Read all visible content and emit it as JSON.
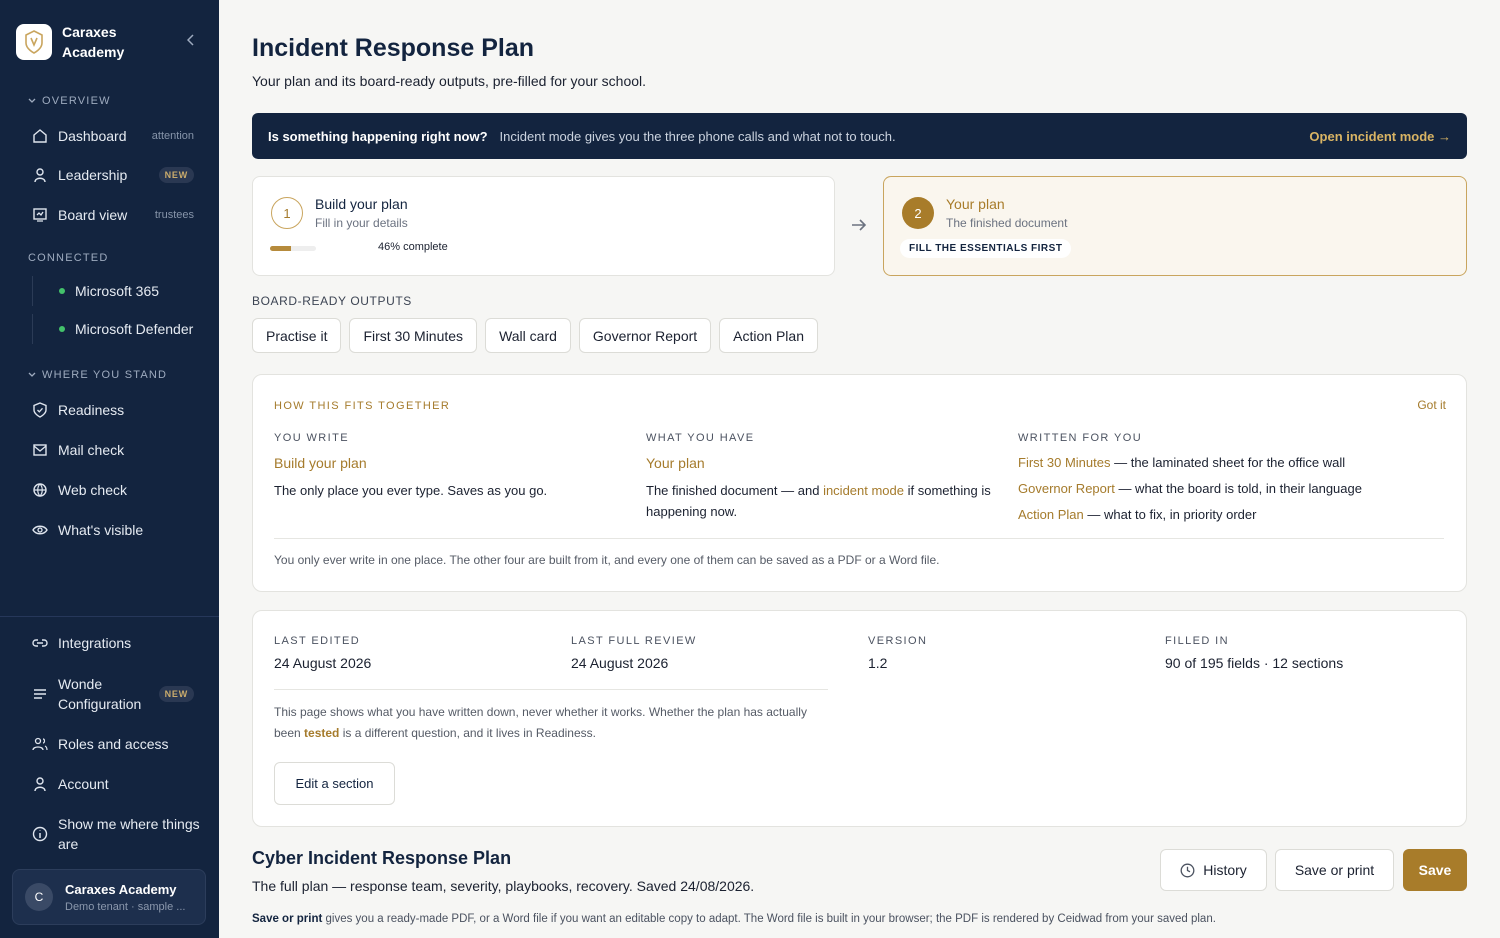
{
  "app": {
    "name": "Caraxes Academy"
  },
  "sidebar": {
    "overview_label": "OVERVIEW",
    "overview": [
      {
        "label": "Dashboard",
        "tag": "attention"
      },
      {
        "label": "Leadership",
        "badge": "NEW"
      },
      {
        "label": "Board view",
        "tag": "trustees"
      }
    ],
    "connected_label": "CONNECTED",
    "connected": [
      {
        "label": "Microsoft 365"
      },
      {
        "label": "Microsoft Defender"
      }
    ],
    "where_label": "WHERE YOU STAND",
    "where": [
      {
        "label": "Readiness"
      },
      {
        "label": "Mail check"
      },
      {
        "label": "Web check"
      },
      {
        "label": "What's visible"
      }
    ],
    "bottom": [
      {
        "label": "Integrations"
      },
      {
        "label": "Wonde Configuration",
        "badge": "NEW"
      },
      {
        "label": "Roles and access"
      },
      {
        "label": "Account"
      },
      {
        "label": "Show me where things are"
      }
    ],
    "tenant": {
      "initial": "C",
      "name": "Caraxes Academy",
      "sub": "Demo tenant · sample ..."
    }
  },
  "page": {
    "title": "Incident Response Plan",
    "subtitle": "Your plan and its board-ready outputs, pre-filled for your school."
  },
  "alert": {
    "question": "Is something happening right now?",
    "desc": "Incident mode gives you the three phone calls and what not to touch.",
    "cta": "Open incident mode →"
  },
  "steps": [
    {
      "num": "1",
      "title": "Build your plan",
      "sub": "Fill in your details",
      "progress": 0.46,
      "progress_label": "46% complete"
    },
    {
      "num": "2",
      "title": "Your plan",
      "sub": "The finished document",
      "pill": "FILL THE ESSENTIALS FIRST"
    }
  ],
  "outputs": {
    "label": "BOARD-READY OUTPUTS",
    "tabs": [
      "Practise it",
      "First 30 Minutes",
      "Wall card",
      "Governor Report",
      "Action Plan"
    ]
  },
  "fits": {
    "eyebrow": "HOW THIS FITS TOGETHER",
    "dismiss": "Got it",
    "cols": [
      {
        "head": "YOU WRITE",
        "title": "Build your plan",
        "body": "The only place you ever type. Saves as you go."
      },
      {
        "head": "WHAT YOU HAVE",
        "title": "Your plan",
        "body_a": "The finished document — and ",
        "body_link": "incident mode",
        "body_b": " if something is happening now."
      },
      {
        "head": "WRITTEN FOR YOU",
        "items": [
          {
            "link": "First 30 Minutes",
            "rest": " — the laminated sheet for the office wall"
          },
          {
            "link": "Governor Report",
            "rest": " — what the board is told, in their language"
          },
          {
            "link": "Action Plan",
            "rest": " — what to fix, in priority order"
          }
        ]
      }
    ],
    "note": "You only ever write in one place. The other four are built from it, and every one of them can be saved as a PDF or a Word file."
  },
  "meta": {
    "fields": [
      {
        "label": "LAST EDITED",
        "value": "24 August 2026"
      },
      {
        "label": "LAST FULL REVIEW",
        "value": "24 August 2026"
      },
      {
        "label": "VERSION",
        "value": "1.2"
      },
      {
        "label": "FILLED IN",
        "value": "90 of 195 fields · 12 sections"
      }
    ],
    "note_a": "This page shows what you have written down, never whether it works. Whether the plan has actually been ",
    "note_link": "tested",
    "note_b": " is a different question, and it lives in Readiness.",
    "edit_btn": "Edit a section"
  },
  "cyber": {
    "title": "Cyber Incident Response Plan",
    "sub": "The full plan — response team, severity, playbooks, recovery. Saved 24/08/2026.",
    "history_btn": "History",
    "print_btn": "Save or print",
    "save_btn": "Save",
    "foot_bold": "Save or print",
    "foot_rest": " gives you a ready-made PDF, or a Word file if you want an editable copy to adapt. The Word file is built in your browser; the PDF is rendered by Ceidwad from your saved plan."
  },
  "colors": {
    "navy": "#13243f",
    "gold": "#a87c2a",
    "bg": "#f6f6f4"
  }
}
